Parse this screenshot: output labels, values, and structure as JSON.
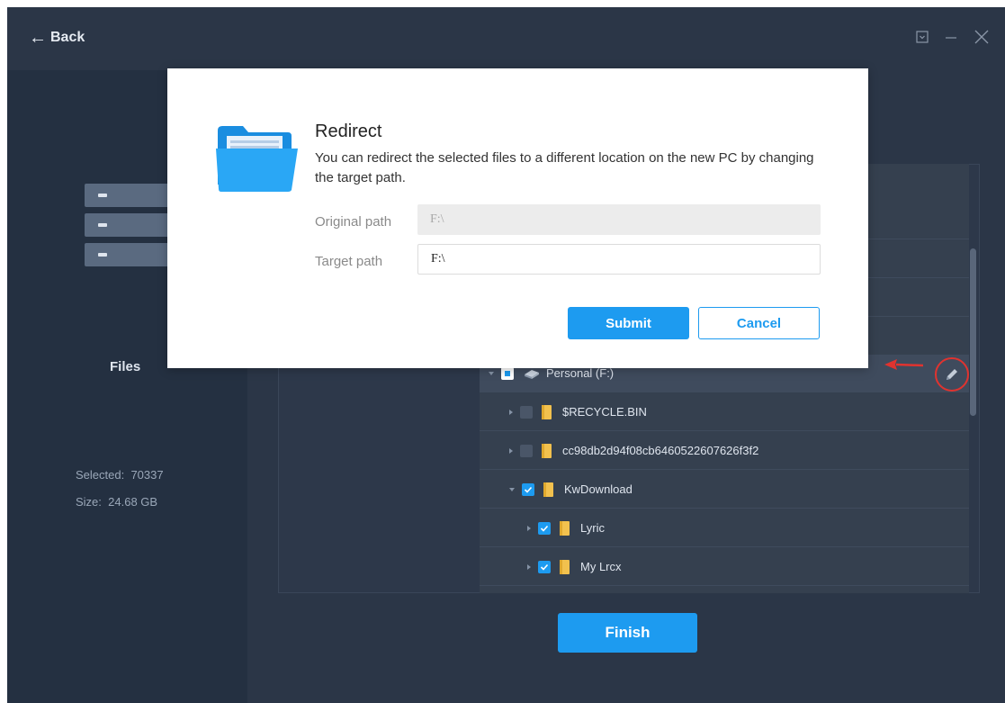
{
  "header": {
    "back_label": "Back"
  },
  "left_panel": {
    "category_label": "Files",
    "selected_label": "Selected:",
    "selected_value": "70337",
    "size_label": "Size:",
    "size_value": "24.68 GB"
  },
  "tree": {
    "items": [
      {
        "label": "Personal (F:)",
        "state": "partial",
        "expanded": true
      },
      {
        "label": "$RECYCLE.BIN",
        "state": "unchecked",
        "expanded": false
      },
      {
        "label": "cc98db2d94f08cb6460522607626f3f2",
        "state": "unchecked",
        "expanded": false
      },
      {
        "label": "KwDownload",
        "state": "checked",
        "expanded": true
      },
      {
        "label": "Lyric",
        "state": "checked",
        "expanded": false
      },
      {
        "label": "My Lrcx",
        "state": "checked",
        "expanded": false
      }
    ]
  },
  "footer": {
    "finish_label": "Finish"
  },
  "modal": {
    "title": "Redirect",
    "description": "You can redirect the selected files to a different location on the new PC by changing the target path.",
    "original_path_label": "Original path",
    "original_path_value": "F:\\",
    "target_path_label": "Target path",
    "target_path_value": "F:\\",
    "submit_label": "Submit",
    "cancel_label": "Cancel"
  },
  "colors": {
    "background": "#2b3647",
    "sidebar": "#243041",
    "accent": "#1d9bf0",
    "annotation": "#e0332f"
  },
  "icons": [
    "back-arrow-icon",
    "minimize-to-tray-icon",
    "minimize-icon",
    "close-icon",
    "drive-icon",
    "folder-icon",
    "edit-pencil-icon",
    "open-folder-icon"
  ]
}
